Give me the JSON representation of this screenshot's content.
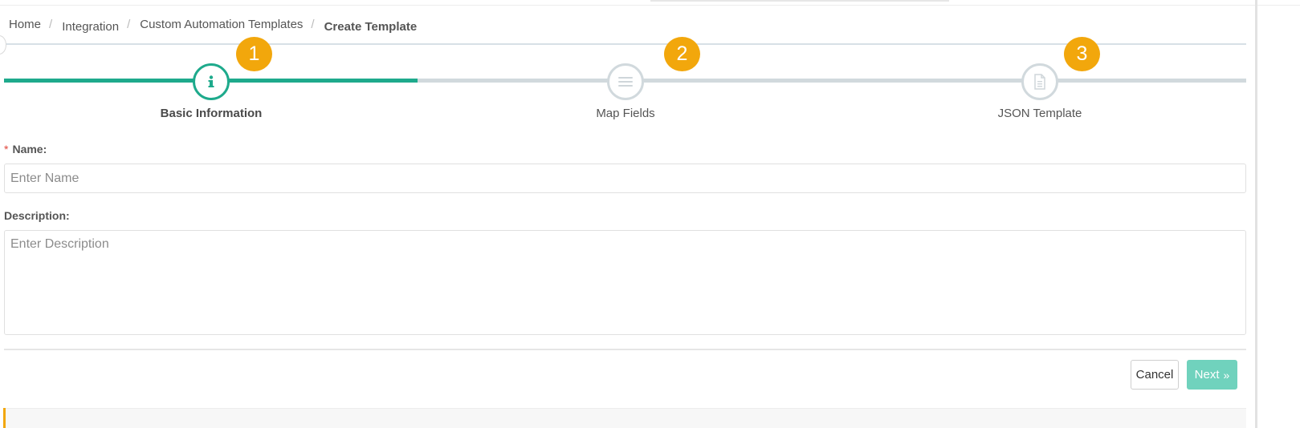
{
  "breadcrumb": {
    "items": [
      "Home",
      "Integration",
      "Custom Automation Templates"
    ],
    "current": "Create Template",
    "separator": "/"
  },
  "wizard": {
    "active_step": 1,
    "progress_fraction": 0.333,
    "steps": [
      {
        "number": "1",
        "label": "Basic Information",
        "icon": "info-icon"
      },
      {
        "number": "2",
        "label": "Map Fields",
        "icon": "list-icon"
      },
      {
        "number": "3",
        "label": "JSON Template",
        "icon": "document-icon"
      }
    ]
  },
  "form": {
    "name": {
      "label": "Name:",
      "required_marker": "*",
      "placeholder": "Enter Name",
      "value": ""
    },
    "description": {
      "label": "Description:",
      "placeholder": "Enter Description",
      "value": ""
    }
  },
  "actions": {
    "cancel": "Cancel",
    "next": "Next",
    "next_icon": "»"
  },
  "colors": {
    "accent": "#1eaa8c",
    "badge": "#f2a70c",
    "next_button": "#70d2bd",
    "track": "#d1d9dd"
  }
}
